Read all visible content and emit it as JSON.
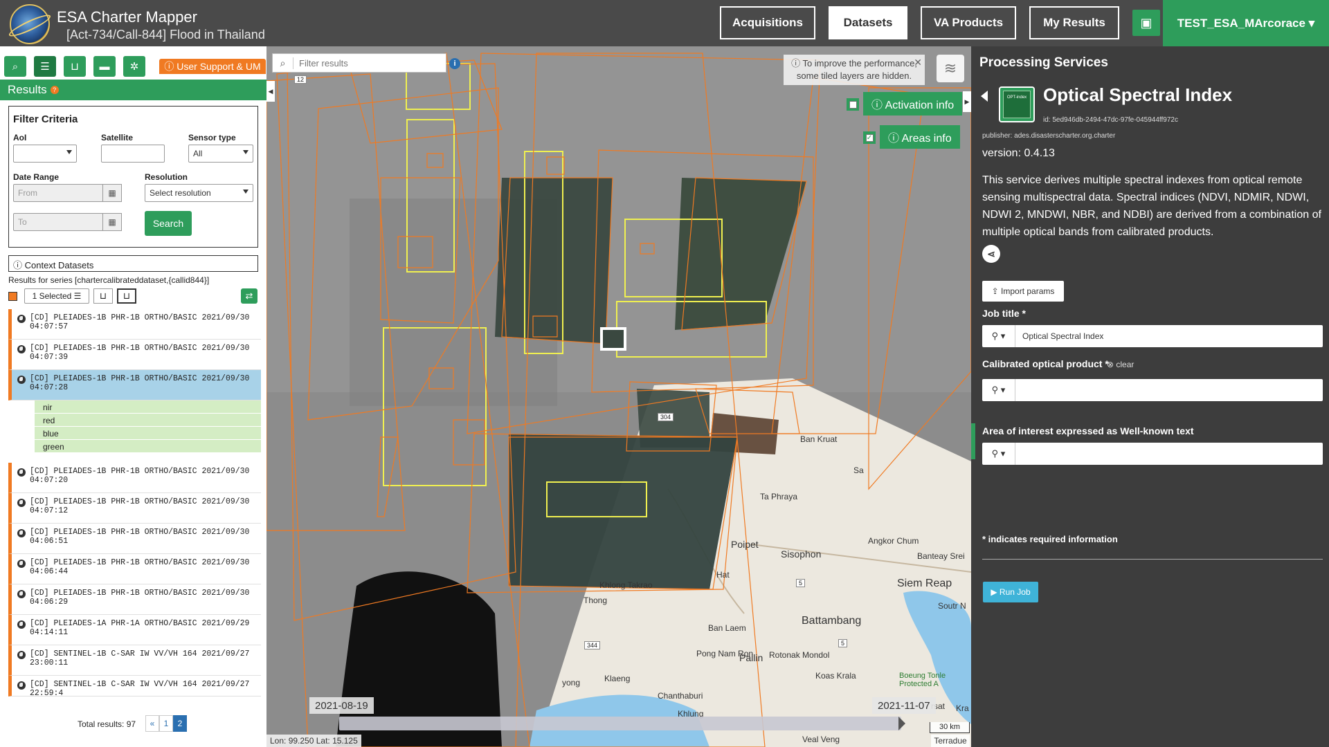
{
  "header": {
    "app_title": "ESA Charter Mapper",
    "subtitle": "[Act-734/Call-844] Flood in Thailand",
    "nav": {
      "acquisitions": "Acquisitions",
      "datasets": "Datasets",
      "va_products": "VA Products",
      "my_results": "My Results"
    },
    "user": "TEST_ESA_MArcorace ▾"
  },
  "left": {
    "support_label": "ⓘ User Support & UM",
    "results_title": "Results",
    "filter": {
      "title": "Filter Criteria",
      "aoi_label": "AoI",
      "satellite_label": "Satellite",
      "sensor_label": "Sensor type",
      "sensor_value": "All",
      "date_label": "Date Range",
      "from_placeholder": "From",
      "to_placeholder": "To",
      "resolution_label": "Resolution",
      "resolution_value": "Select resolution",
      "search_label": "Search"
    },
    "context_label": "ⓘ Context Datasets",
    "series_label": "Results for series [chartercalibrateddataset,{callid844}]",
    "selected_label": "1 Selected ☰",
    "items": [
      "[CD] PLEIADES-1B PHR-1B ORTHO/BASIC 2021/09/30 04:07:57",
      "[CD] PLEIADES-1B PHR-1B ORTHO/BASIC 2021/09/30 04:07:39",
      "[CD] PLEIADES-1B PHR-1B ORTHO/BASIC 2021/09/30 04:07:28",
      "[CD] PLEIADES-1B PHR-1B ORTHO/BASIC 2021/09/30 04:07:20",
      "[CD] PLEIADES-1B PHR-1B ORTHO/BASIC 2021/09/30 04:07:12",
      "[CD] PLEIADES-1B PHR-1B ORTHO/BASIC 2021/09/30 04:06:51",
      "[CD] PLEIADES-1B PHR-1B ORTHO/BASIC 2021/09/30 04:06:44",
      "[CD] PLEIADES-1B PHR-1B ORTHO/BASIC 2021/09/30 04:06:29",
      "[CD] PLEIADES-1A PHR-1A ORTHO/BASIC 2021/09/29 04:14:11",
      "[CD] SENTINEL-1B C-SAR IW VV/VH 164 2021/09/27 23:00:11",
      "[CD] SENTINEL-1B C-SAR IW VV/VH 164 2021/09/27 22:59:4"
    ],
    "bands": [
      "nir",
      "red",
      "blue",
      "green"
    ],
    "total": "Total results: 97",
    "pages": {
      "prev": "«",
      "p1": "1",
      "p2": "2"
    }
  },
  "map": {
    "filter_placeholder": "Filter results",
    "perf_note": "ⓘ To improve the performance, some tiled layers are hidden.",
    "activation_info": "ⓘ Activation info",
    "areas_info": "ⓘ Areas info",
    "date_start": "2021-08-19",
    "date_end": "2021-11-07",
    "coords": "Lon: 99.250 Lat: 15.125",
    "scale": "30 km",
    "attribution": "Terradue",
    "road_labels": [
      "12",
      "304",
      "5",
      "5",
      "344"
    ],
    "place_labels": [
      "Ban Kruat",
      "Sa",
      "Ta Phraya",
      "Poipet",
      "Sisophon",
      "Angkor Chum",
      "Banteay Srei",
      "Siem Reap",
      "Hat",
      "Khlong Takrao",
      "Thong",
      "Ban Laem",
      "Battambang",
      "Soutr N",
      "Pong Nam Ron",
      "Pailin",
      "Rotonak Mondol",
      "Klaeng",
      "Koas Krala",
      "Boeung Tonle",
      "Protected A",
      "yong",
      "Chanthaburi",
      "Khlung",
      "rsat",
      "Kra",
      "Veal Veng"
    ]
  },
  "right": {
    "section_title": "Processing Services",
    "service_name": "Optical Spectral Index",
    "icon_label": "OPT-index",
    "service_id": "id: 5ed946db-2494-47dc-97fe-045944ff972c",
    "publisher": "publisher: ades.disasterscharter.org.charter",
    "version": "version: 0.4.13",
    "description": "This service derives multiple spectral indexes from optical remote sensing multispectral data. Spectral indices (NDVI, NDMIR, NDWI, NDWI 2, MNDWI, NBR, and NDBI) are derived from a combination of multiple optical bands from calibrated products.",
    "import_label": "⇪ Import params",
    "job_title_label": "Job title *",
    "job_title_value": "Optical Spectral Index",
    "product_label": "Calibrated optical product *",
    "clear_label": "⊗ clear",
    "aoi_label": "Area of interest expressed as Well-known text",
    "required_note": "* indicates required information",
    "run_label": "▶ Run Job",
    "wand": "⚲ ▾"
  }
}
